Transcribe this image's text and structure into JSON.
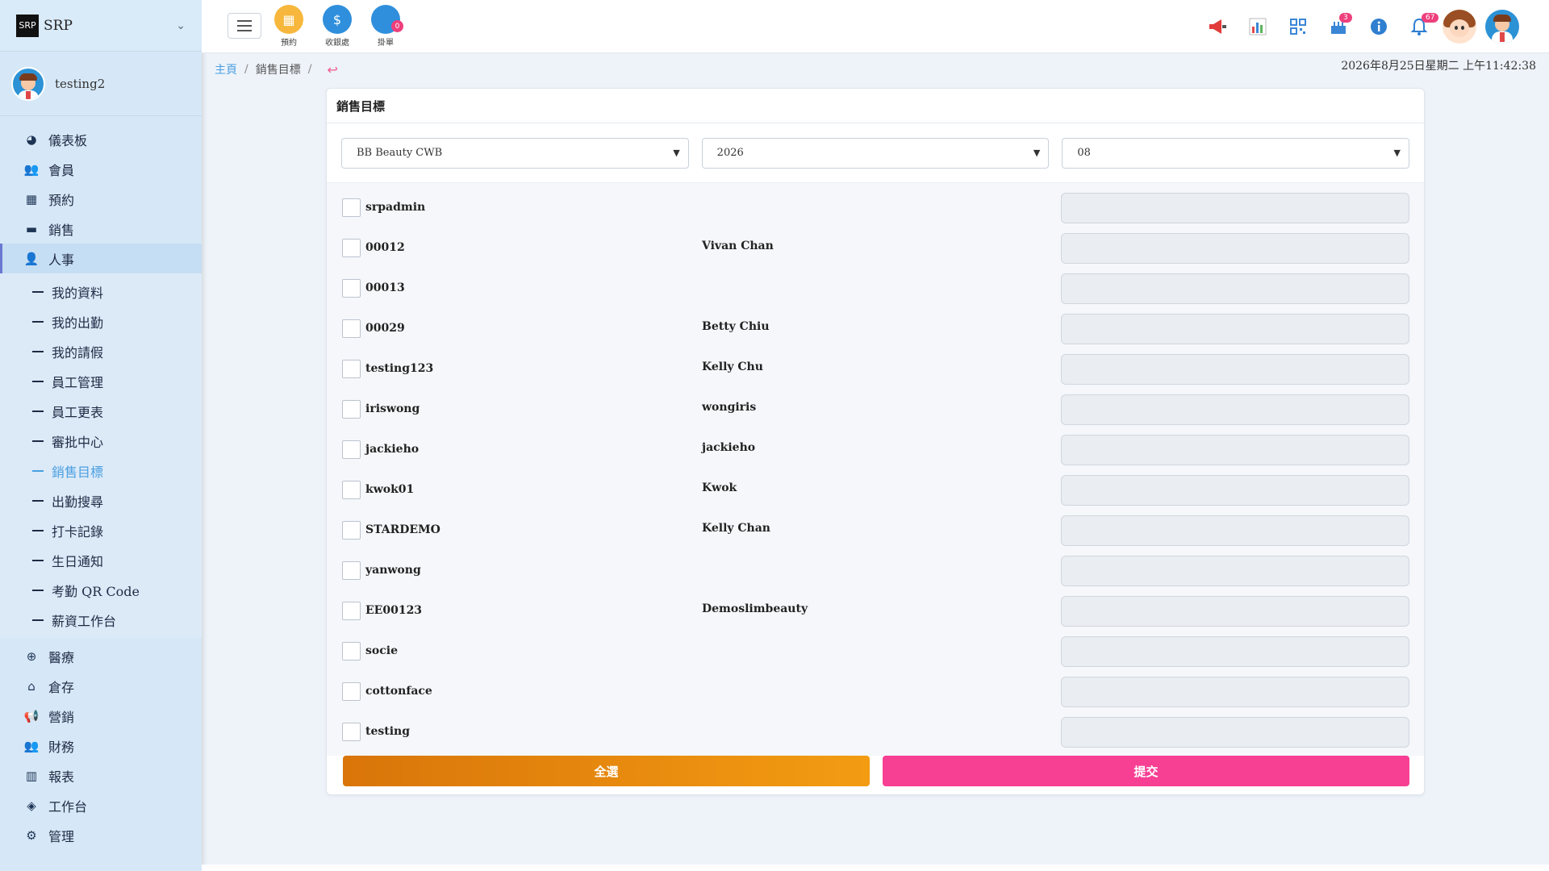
{
  "brand": {
    "name": "SRP",
    "logo_text": "SRP"
  },
  "user": {
    "name": "testing2"
  },
  "sidebar": {
    "items": [
      {
        "label": "儀表板",
        "icon": "◕"
      },
      {
        "label": "會員",
        "icon": "👥"
      },
      {
        "label": "預約",
        "icon": "▦"
      },
      {
        "label": "銷售",
        "icon": "▬"
      },
      {
        "label": "人事",
        "icon": "👤"
      }
    ],
    "submenu": [
      "我的資料",
      "我的出勤",
      "我的請假",
      "員工管理",
      "員工更表",
      "審批中心",
      "銷售目標",
      "出勤搜尋",
      "打卡記錄",
      "生日通知",
      "考勤 QR Code",
      "薪資工作台"
    ],
    "lower": [
      {
        "label": "醫療",
        "icon": "⊕"
      },
      {
        "label": "倉存",
        "icon": "⌂"
      },
      {
        "label": "營銷",
        "icon": "📢"
      },
      {
        "label": "財務",
        "icon": "👥"
      },
      {
        "label": "報表",
        "icon": "▥"
      },
      {
        "label": "工作台",
        "icon": "◈"
      },
      {
        "label": "管理",
        "icon": "⚙"
      }
    ]
  },
  "header": {
    "quick": [
      {
        "label": "預約",
        "color": "#f6b73c"
      },
      {
        "label": "收銀處",
        "color": "#2f8fdc"
      },
      {
        "label": "掛單",
        "color": "#2f8fdc",
        "badge": "0"
      }
    ],
    "cake_badge": "3",
    "bell_badge": "67"
  },
  "breadcrumb": {
    "home": "主頁",
    "current": "銷售目標"
  },
  "datetime": "2026年8月25日星期二 上午11:42:38",
  "card": {
    "title": "銷售目標",
    "filters": {
      "shop": "BB Beauty CWB",
      "year": "2026",
      "month": "08"
    },
    "rows": [
      {
        "code": "srpadmin",
        "name": ""
      },
      {
        "code": "00012",
        "name": "Vivan Chan"
      },
      {
        "code": "00013",
        "name": ""
      },
      {
        "code": "00029",
        "name": "Betty Chiu"
      },
      {
        "code": "testing123",
        "name": "Kelly Chu"
      },
      {
        "code": "iriswong",
        "name": "wongiris"
      },
      {
        "code": "jackieho",
        "name": "jackieho"
      },
      {
        "code": "kwok01",
        "name": "Kwok"
      },
      {
        "code": "STARDEMO",
        "name": "Kelly Chan"
      },
      {
        "code": "yanwong",
        "name": ""
      },
      {
        "code": "EE00123",
        "name": "Demoslimbeauty"
      },
      {
        "code": "socie",
        "name": ""
      },
      {
        "code": "cottonface",
        "name": ""
      },
      {
        "code": "testing",
        "name": ""
      }
    ],
    "select_all_label": "全選",
    "submit_label": "提交"
  }
}
